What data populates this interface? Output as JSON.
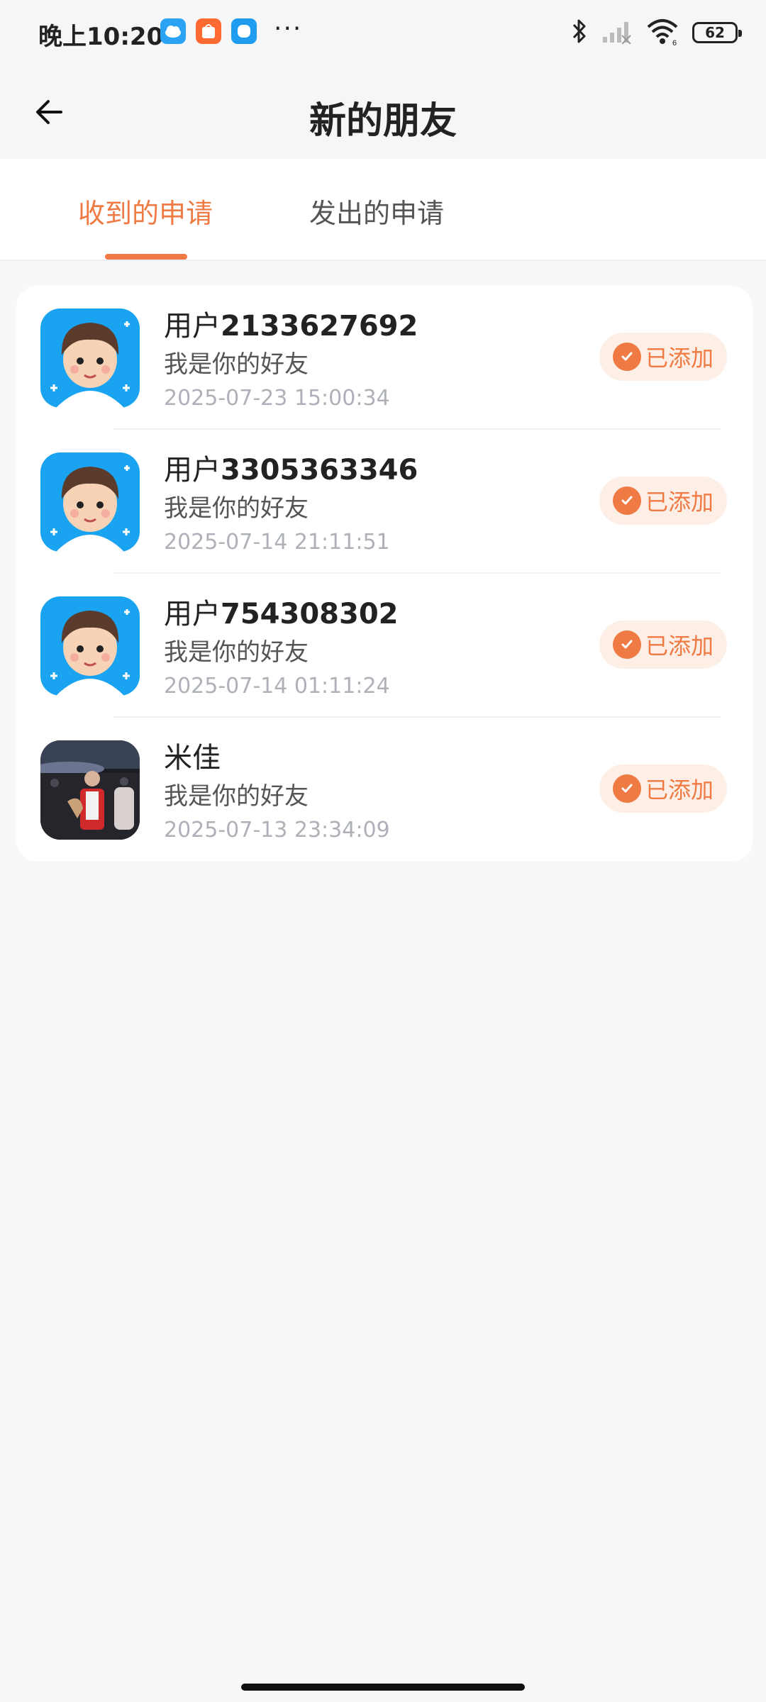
{
  "status_bar": {
    "time": "晚上10:20",
    "more": "···",
    "battery": "62",
    "icons": [
      "cloud-app-icon",
      "orange-app-icon",
      "blue-app-icon",
      "bluetooth-icon",
      "signal-icon",
      "wifi-icon",
      "battery-icon"
    ]
  },
  "header": {
    "title": "新的朋友",
    "back_icon": "back-arrow-icon"
  },
  "tabs": [
    {
      "label": "收到的申请",
      "active": true
    },
    {
      "label": "发出的申请",
      "active": false
    }
  ],
  "colors": {
    "accent": "#f07a44",
    "badge_bg": "#fdeee6"
  },
  "requests": [
    {
      "name_prefix": "用户",
      "name_number": "2133627692",
      "message": "我是你的好友",
      "time": "2025-07-23 15:00:34",
      "status": "已添加",
      "avatar": "cartoon-boy-avatar"
    },
    {
      "name_prefix": "用户",
      "name_number": "3305363346",
      "message": "我是你的好友",
      "time": "2025-07-14 21:11:51",
      "status": "已添加",
      "avatar": "cartoon-boy-avatar"
    },
    {
      "name_prefix": "用户",
      "name_number": "754308302",
      "message": "我是你的好友",
      "time": "2025-07-14 01:11:24",
      "status": "已添加",
      "avatar": "cartoon-boy-avatar"
    },
    {
      "name_prefix": "米佳",
      "name_number": "",
      "message": "我是你的好友",
      "time": "2025-07-13 23:34:09",
      "status": "已添加",
      "avatar": "photo-avatar"
    }
  ]
}
